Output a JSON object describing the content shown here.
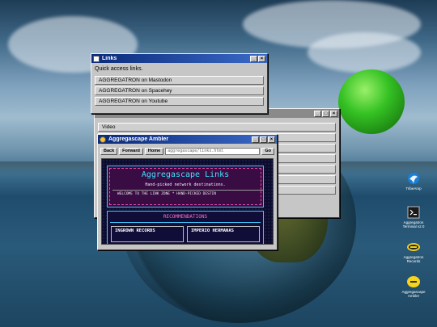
{
  "links_window": {
    "title": "Links",
    "subtitle": "Quick access links.",
    "items": [
      {
        "label": "AGGREGATRON on Mastodon"
      },
      {
        "label": "AGGREGATRON on Spacehey"
      },
      {
        "label": "AGGREGATRON on Youtube"
      }
    ]
  },
  "back_window": {
    "items": [
      {
        "label": "Video"
      }
    ]
  },
  "ambler": {
    "title": "Aggregascape Ambler",
    "back_label": "Back",
    "forward_label": "Forward",
    "home_label": "Home",
    "url": "aggregascape/links.html",
    "go_label": "Go",
    "page": {
      "heading": "Aggregascape Links",
      "tagline": "Hand-picked network destinations.",
      "marquee": "WELCOME TO THE LINK ZONE * HAND-PICKED DESTIN",
      "rec_heading": "RECOMMENDATIONS",
      "cards": [
        {
          "label": "INGROWN RECORDS"
        },
        {
          "label": "IMPERIO HERMANAS"
        }
      ]
    }
  },
  "desktop_icons": [
    {
      "label": "TribeAmp"
    },
    {
      "label": "Aggregatron Terminal v2.0"
    },
    {
      "label": "Aggregatron Records"
    },
    {
      "label": "Aggregascape Ambler"
    }
  ]
}
